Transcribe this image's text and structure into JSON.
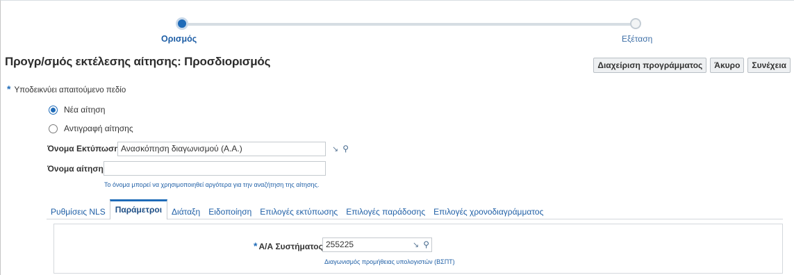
{
  "train": {
    "steps": [
      {
        "label": "Ορισμός",
        "state": "current"
      },
      {
        "label": "Εξέταση",
        "state": "upcoming"
      }
    ]
  },
  "page": {
    "title": "Προγρ/σμός εκτέλεσης αίτησης: Προσδιορισμός"
  },
  "buttons": {
    "manage_schedule": "Διαχείριση προγράμματος",
    "cancel": "Άκυρο",
    "continue": "Συνέχεια"
  },
  "required_note": {
    "star": "*",
    "text": "Υποδεικνύει απαιτούμενο πεδίο"
  },
  "request_type": {
    "options": [
      {
        "label": "Νέα αίτηση",
        "checked": true
      },
      {
        "label": "Αντιγραφή αίτησης",
        "checked": false
      }
    ]
  },
  "form": {
    "print_name_label": "Όνομα Εκτύπωσης",
    "print_name_value": "Ανασκόπηση διαγωνισμού (Α.Α.)",
    "request_name_label": "Όνομα αίτησης",
    "request_name_value": "",
    "request_name_hint": "Το όνομα μπορεί να χρησιμοποιηθεί αργότερα για την αναζήτηση της αίτησης."
  },
  "tabs": [
    {
      "label": "Ρυθμίσεις NLS",
      "active": false
    },
    {
      "label": "Παράμετροι",
      "active": true
    },
    {
      "label": "Διάταξη",
      "active": false
    },
    {
      "label": "Ειδοποίηση",
      "active": false
    },
    {
      "label": "Επιλογές εκτύπωσης",
      "active": false
    },
    {
      "label": "Επιλογές παράδοσης",
      "active": false
    },
    {
      "label": "Επιλογές χρονοδιαγράμματος",
      "active": false
    }
  ],
  "parameters": {
    "star": "*",
    "system_id_label": "Α/Α Συστήματος",
    "system_id_value": "255225",
    "system_id_description": "Διαγωνισμός προμήθειας υπολογιστών (ΒΣΠΤ)"
  },
  "icons": {
    "lov": "lov-icon",
    "search": "search-icon"
  },
  "colors": {
    "accent": "#1f6bb8",
    "link": "#1f5fa6"
  }
}
